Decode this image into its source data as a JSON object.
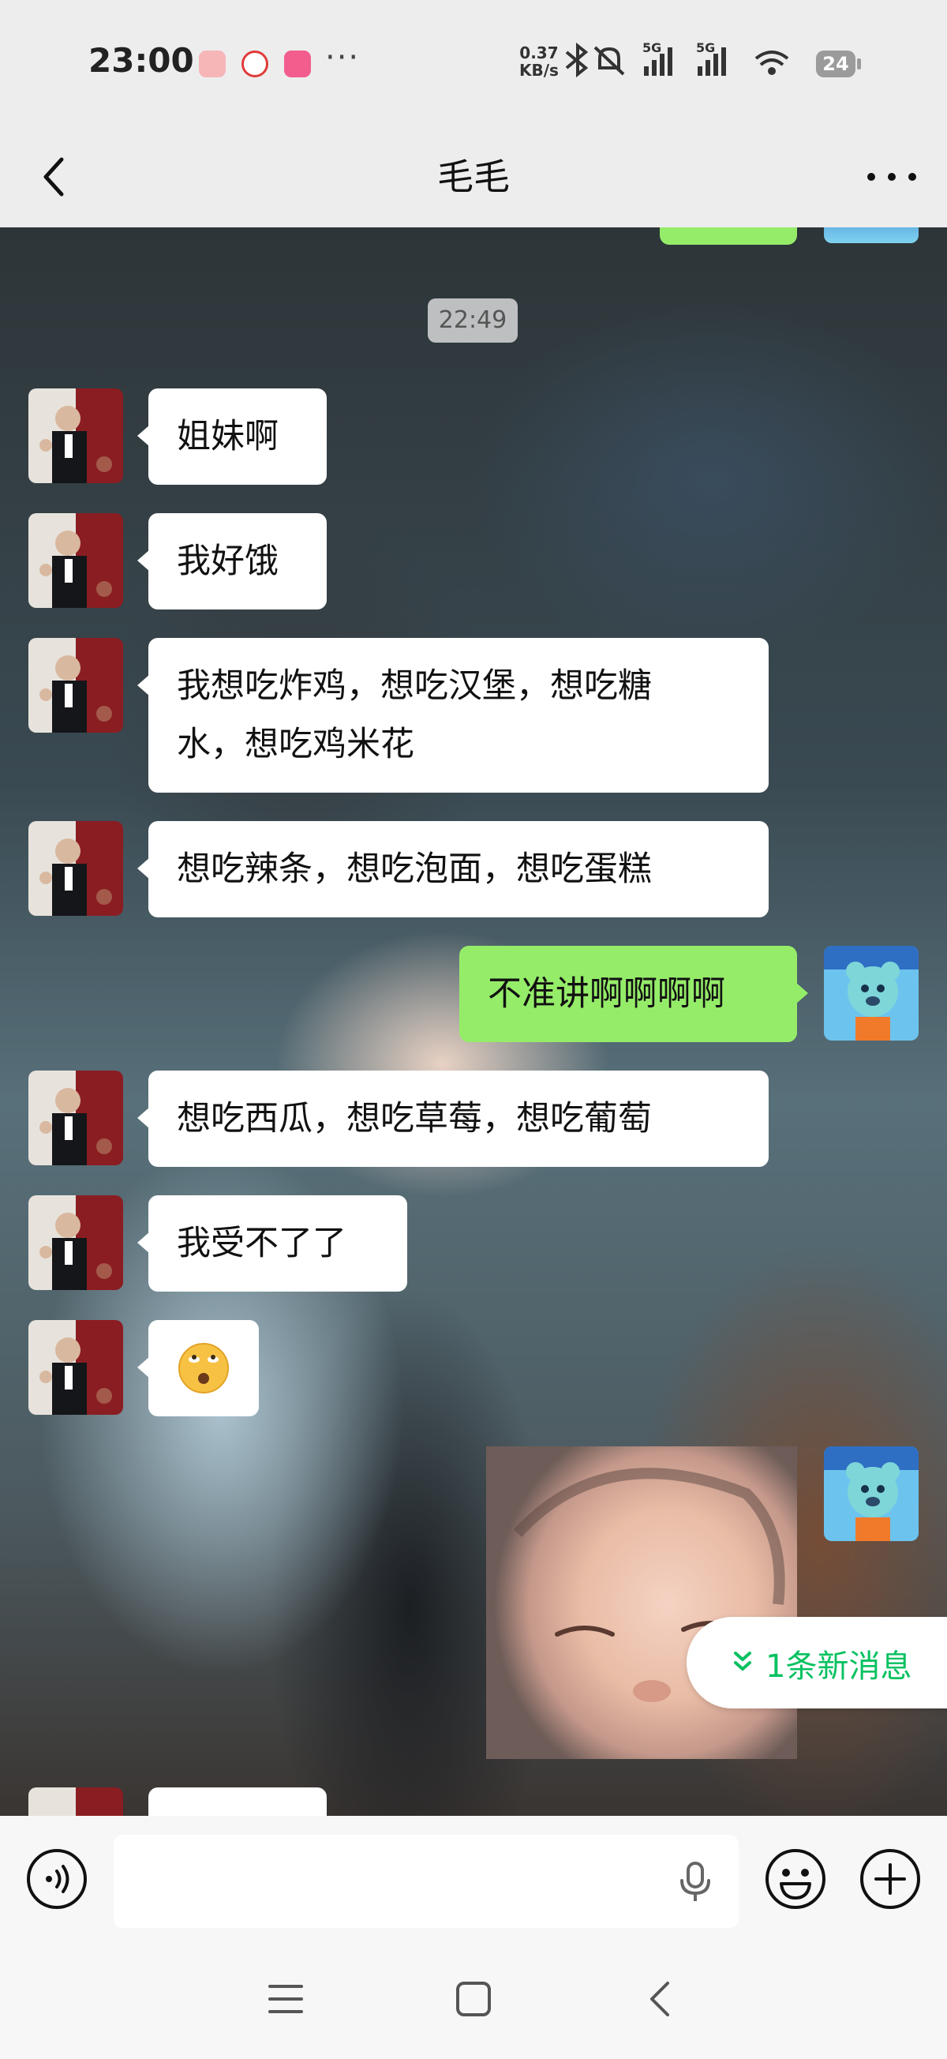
{
  "status_bar": {
    "time": "23:00",
    "more": "···",
    "net_speed_value": "0.37",
    "net_speed_unit": "KB/s",
    "signal_label_1": "5G",
    "signal_label_2": "5G",
    "battery": "24",
    "app_icons": [
      "weibo-icon",
      "app-red-icon",
      "bilibili-icon"
    ]
  },
  "header": {
    "title": "毛毛"
  },
  "chat": {
    "timestamp": "22:49",
    "messages": [
      {
        "side": "left",
        "text": "姐妹啊"
      },
      {
        "side": "left",
        "text": "我好饿"
      },
      {
        "side": "left",
        "line1": "我想吃炸鸡，想吃汉堡，想吃糖",
        "line2": "水，想吃鸡米花"
      },
      {
        "side": "left",
        "text": "想吃辣条，想吃泡面，想吃蛋糕"
      },
      {
        "side": "right",
        "text": "不准讲啊啊啊啊"
      },
      {
        "side": "left",
        "text": "想吃西瓜，想吃草莓，想吃葡萄"
      },
      {
        "side": "left",
        "text": "我受不了了"
      },
      {
        "side": "left",
        "text": "🙄"
      },
      {
        "side": "right",
        "type": "image"
      }
    ],
    "new_message_notice": "1条新消息"
  },
  "colors": {
    "bubble_self": "#95ec69",
    "bubble_other": "#ffffff",
    "accent": "#07c160",
    "bar_bg": "#ededed"
  }
}
